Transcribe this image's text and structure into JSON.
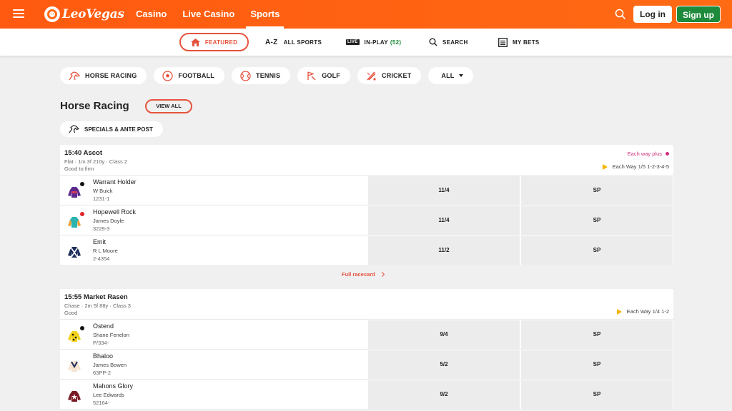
{
  "header": {
    "logo_text": "LeoVegas",
    "nav": [
      "Casino",
      "Live Casino",
      "Sports"
    ],
    "active_nav": "Sports",
    "login_label": "Log in",
    "signup_label": "Sign up",
    "brand_color": "#ff5a10",
    "signup_color": "#1e8a3c"
  },
  "subnav": {
    "featured": "FEATURED",
    "all_sports_prefix": "A-Z",
    "all_sports": "ALL SPORTS",
    "live_badge": "LIVE",
    "in_play": "IN-PLAY",
    "in_play_count": "(52)",
    "search": "SEARCH",
    "my_bets": "MY BETS"
  },
  "sports_chips": [
    "HORSE RACING",
    "FOOTBALL",
    "TENNIS",
    "GOLF",
    "CRICKET",
    "ALL"
  ],
  "section": {
    "title": "Horse Racing",
    "view_all": "VIEW ALL",
    "specials": "SPECIALS & ANTE POST",
    "full_racecard": "Full racecard"
  },
  "races": [
    {
      "title": "15:40 Ascot",
      "meta1": "Flat · 1m 3f 210y · Class 2",
      "meta2": "Good to firm",
      "each_way_plus": "Each way plus",
      "each_way_terms": "Each Way 1/5 1-2-3-4-5",
      "runners": [
        {
          "name": "Warrant Holder",
          "jockey": "W Buick",
          "form": "1231-1",
          "odds": "11/4",
          "sp": "SP"
        },
        {
          "name": "Hopewell Rock",
          "jockey": "James Doyle",
          "form": "3229-3",
          "odds": "11/4",
          "sp": "SP"
        },
        {
          "name": "Emit",
          "jockey": "R L Moore",
          "form": "2-4354",
          "odds": "11/2",
          "sp": "SP"
        }
      ]
    },
    {
      "title": "15:55 Market Rasen",
      "meta1": "Chase · 2m 5f 88y · Class 3",
      "meta2": "Good",
      "each_way_terms": "Each Way 1/4 1-2",
      "runners": [
        {
          "name": "Ostend",
          "jockey": "Shane Fenelon",
          "form": "P/334-",
          "odds": "9/4",
          "sp": "SP"
        },
        {
          "name": "Bhaloo",
          "jockey": "James Bowen",
          "form": "63PP-2",
          "odds": "5/2",
          "sp": "SP"
        },
        {
          "name": "Mahons Glory",
          "jockey": "Lee Edwards",
          "form": "52164-",
          "odds": "9/2",
          "sp": "SP"
        }
      ]
    }
  ]
}
